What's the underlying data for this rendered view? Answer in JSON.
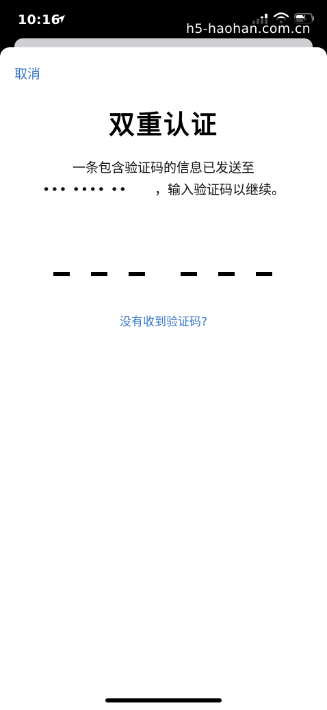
{
  "status_bar": {
    "time": "10:16",
    "icons": [
      "location-arrow-icon",
      "cellular-signal-icon",
      "wifi-icon",
      "battery-charging-icon"
    ]
  },
  "watermark": "h5-haohan.com.cn",
  "sheet": {
    "cancel_label": "取消",
    "title": "双重认证",
    "message_line1": "一条包含验证码的信息已发送至",
    "message_masked": "••• •••• ••",
    "message_line2": "，输入验证码以继续。",
    "code_digits": [
      "",
      "",
      "",
      "",
      "",
      ""
    ],
    "resend_label": "没有收到验证码?"
  },
  "colors": {
    "link": "#3a78c9",
    "background": "#ffffff",
    "status_bar": "#000000"
  }
}
